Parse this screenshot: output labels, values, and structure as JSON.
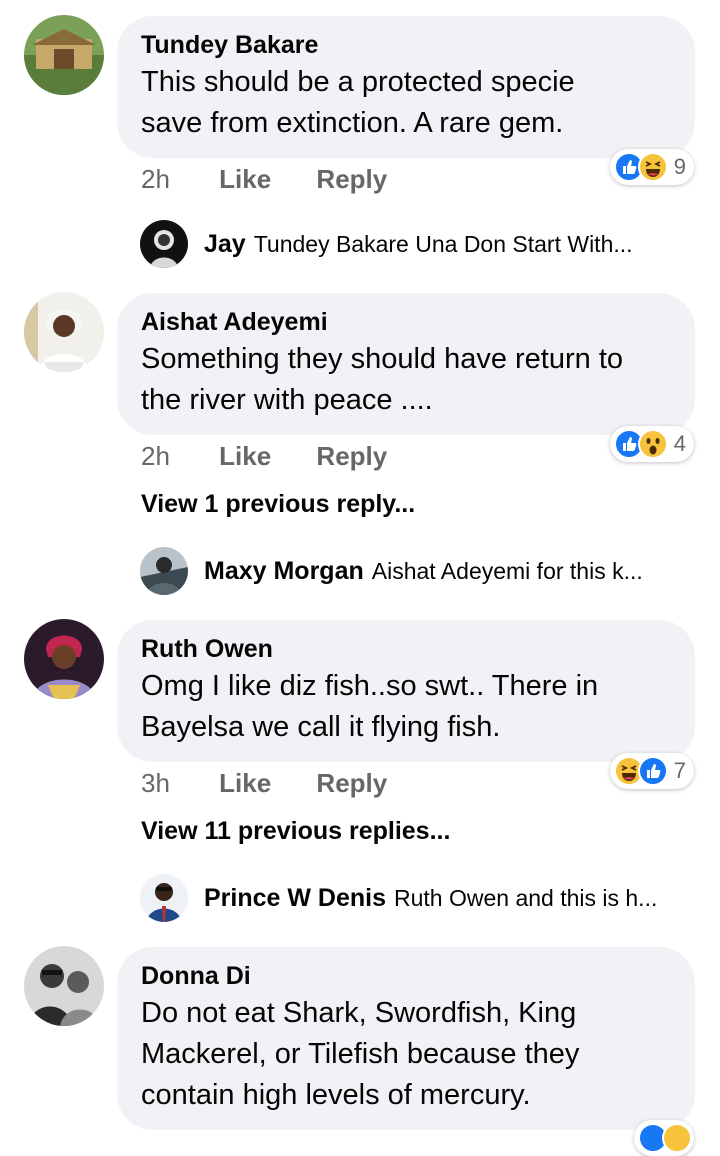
{
  "actions": {
    "like": "Like",
    "reply": "Reply"
  },
  "comments": [
    {
      "author": "Tundey Bakare",
      "lines": [
        "This should be a protected specie",
        "save from extinction. A rare gem."
      ],
      "time": "2h",
      "reactions": {
        "icons": [
          "like-icon",
          "haha-icon"
        ],
        "count": "9"
      },
      "reply_preview": {
        "name": "Jay",
        "text": "Tundey Bakare  Una Don Start With..."
      }
    },
    {
      "author": "Aishat Adeyemi",
      "lines": [
        "Something they should have return to",
        "the river with peace ...."
      ],
      "time": "2h",
      "reactions": {
        "icons": [
          "like-icon",
          "wow-icon"
        ],
        "count": "4"
      },
      "view_previous": "View 1 previous reply...",
      "reply_preview": {
        "name": "Maxy Morgan",
        "text": "Aishat Adeyemi for this k..."
      }
    },
    {
      "author": "Ruth Owen",
      "lines": [
        "Omg I  like diz fish..so swt.. There in",
        "Bayelsa we call it flying fish."
      ],
      "time": "3h",
      "reactions": {
        "icons": [
          "haha-icon",
          "like-icon"
        ],
        "count": "7"
      },
      "view_previous": "View 11 previous replies...",
      "reply_preview": {
        "name": "Prince W Denis",
        "text": "Ruth Owen and this is h..."
      }
    },
    {
      "author": "Donna Di",
      "lines": [
        "Do not eat Shark, Swordfish, King",
        "Mackerel, or Tilefish because they",
        "contain high levels of mercury."
      ]
    }
  ],
  "colors": {
    "bubble": "#f0f2f5",
    "like_blue": "#1877f2",
    "emoji_yellow": "#f7c33d",
    "meta_gray": "#65676b"
  }
}
